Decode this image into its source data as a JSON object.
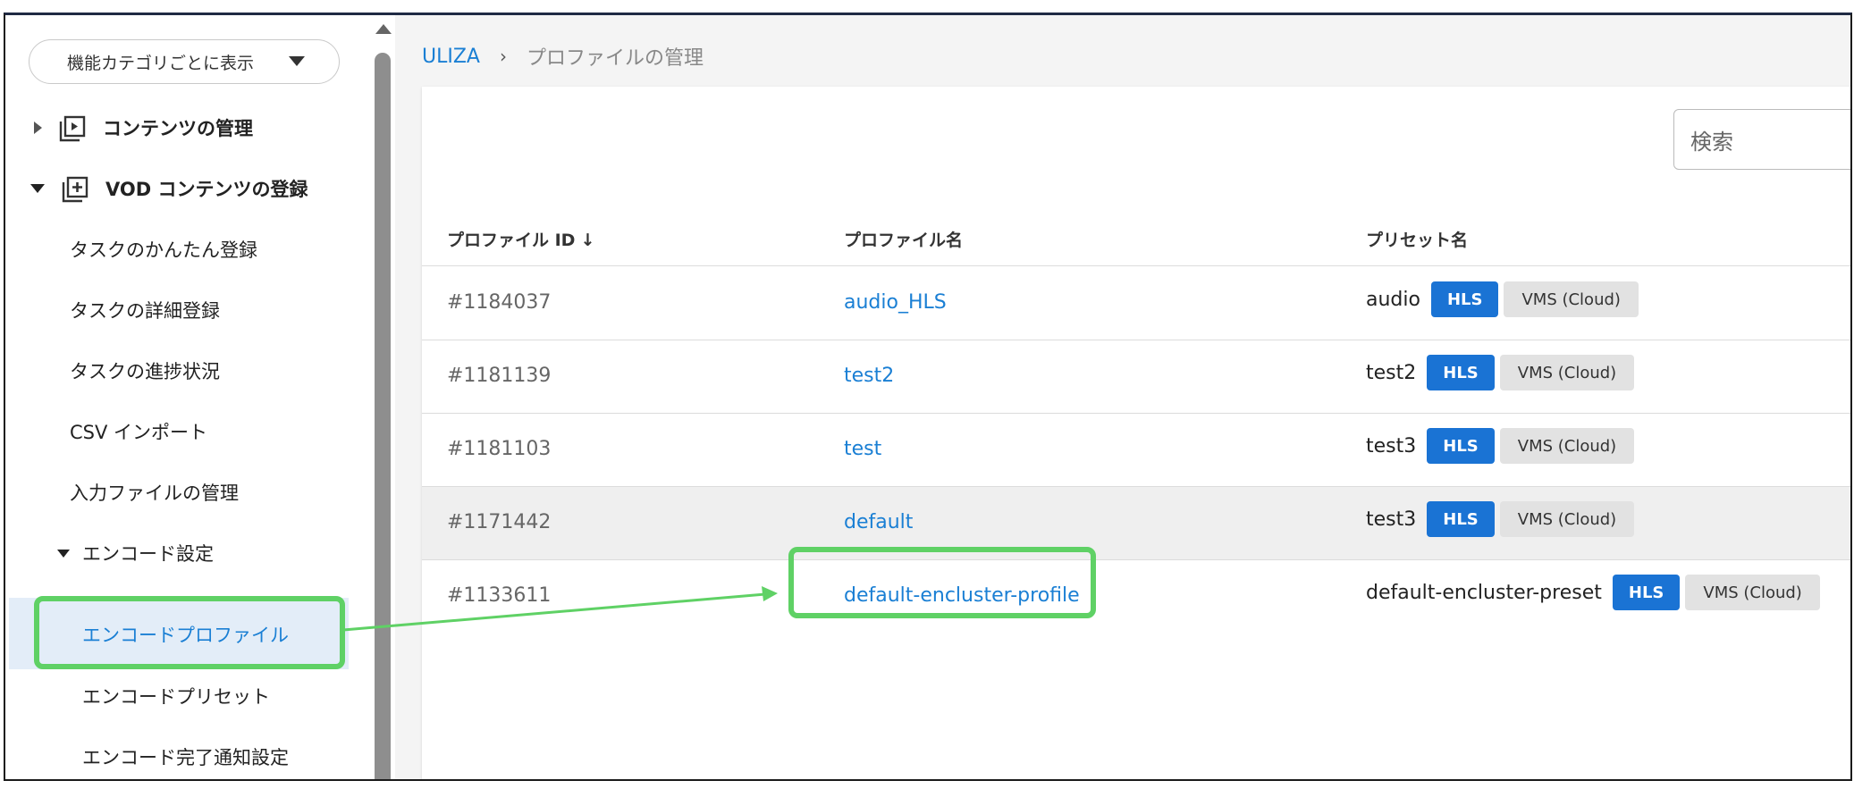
{
  "sidebar": {
    "category_select": "機能カテゴリごとに表示",
    "items": [
      {
        "label": "コンテンツの管理"
      },
      {
        "label": "VOD コンテンツの登録"
      },
      {
        "label": "タスクのかんたん登録"
      },
      {
        "label": "タスクの詳細登録"
      },
      {
        "label": "タスクの進捗状況"
      },
      {
        "label": "CSV インポート"
      },
      {
        "label": "入力ファイルの管理"
      },
      {
        "label": "エンコード設定"
      },
      {
        "label": "エンコードプロファイル"
      },
      {
        "label": "エンコードプリセット"
      },
      {
        "label": "エンコード完了通知設定"
      }
    ]
  },
  "breadcrumb": {
    "root": "ULIZA",
    "separator": "›",
    "current": "プロファイルの管理"
  },
  "search": {
    "placeholder": "検索"
  },
  "table": {
    "headers": {
      "id": "プロファイル ID",
      "id_sort_icon": "↓",
      "name": "プロファイル名",
      "preset": "プリセット名"
    },
    "rows": [
      {
        "id": "#1184037",
        "name": "audio_HLS",
        "preset": "audio",
        "format": "HLS",
        "platform": "VMS (Cloud)"
      },
      {
        "id": "#1181139",
        "name": "test2",
        "preset": "test2",
        "format": "HLS",
        "platform": "VMS (Cloud)"
      },
      {
        "id": "#1181103",
        "name": "test",
        "preset": "test3",
        "format": "HLS",
        "platform": "VMS (Cloud)"
      },
      {
        "id": "#1171442",
        "name": "default",
        "preset": "test3",
        "format": "HLS",
        "platform": "VMS (Cloud)"
      },
      {
        "id": "#1133611",
        "name": "default-encluster-profile",
        "preset": "default-encluster-preset",
        "format": "HLS",
        "platform": "VMS (Cloud)"
      }
    ]
  },
  "colors": {
    "link": "#1a7fd4",
    "highlight_annotation": "#5fd165",
    "hls_badge": "#1a73d4",
    "active_nav_bg": "#e3edf8"
  }
}
